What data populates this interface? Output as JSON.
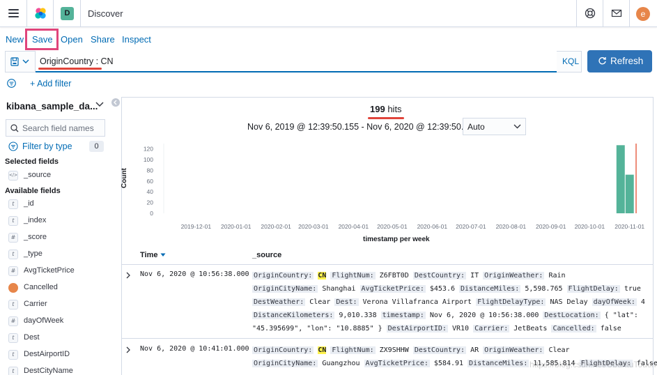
{
  "header": {
    "space_initial": "D",
    "app_title": "Discover",
    "user_initial": "e"
  },
  "nav": {
    "new": "New",
    "save": "Save",
    "open": "Open",
    "share": "Share",
    "inspect": "Inspect"
  },
  "query": {
    "value": "OriginCountry : CN",
    "language": "KQL",
    "refresh_label": "Refresh"
  },
  "filters": {
    "add_filter": "+ Add filter"
  },
  "sidebar": {
    "index_pattern": "kibana_sample_da...",
    "search_placeholder": "Search field names",
    "filter_by_type": "Filter by type",
    "filter_count": "0",
    "selected_title": "Selected fields",
    "selected_fields": [
      {
        "name": "_source",
        "type": "</>"
      }
    ],
    "available_title": "Available fields",
    "available_fields": [
      {
        "name": "_id",
        "type": "t"
      },
      {
        "name": "_index",
        "type": "t"
      },
      {
        "name": "_score",
        "type": "#"
      },
      {
        "name": "_type",
        "type": "t"
      },
      {
        "name": "AvgTicketPrice",
        "type": "#"
      },
      {
        "name": "Cancelled",
        "type": "bool"
      },
      {
        "name": "Carrier",
        "type": "t"
      },
      {
        "name": "dayOfWeek",
        "type": "#"
      },
      {
        "name": "Dest",
        "type": "t"
      },
      {
        "name": "DestAirportID",
        "type": "t"
      },
      {
        "name": "DestCityName",
        "type": "t"
      }
    ]
  },
  "results": {
    "hits_count": "199",
    "hits_label": "hits",
    "time_range": "Nov 6, 2019 @ 12:39:50.155 - Nov 6, 2020 @ 12:39:50.155",
    "interval": "Auto"
  },
  "chart_data": {
    "type": "bar",
    "ylabel": "Count",
    "xlabel": "timestamp per week",
    "ylim": [
      0,
      130
    ],
    "yticks": [
      "0",
      "20",
      "40",
      "60",
      "80",
      "100",
      "120"
    ],
    "xticks": [
      "2019-12-01",
      "2020-01-01",
      "2020-02-01",
      "2020-03-01",
      "2020-04-01",
      "2020-05-01",
      "2020-06-01",
      "2020-07-01",
      "2020-08-01",
      "2020-09-01",
      "2020-10-01",
      "2020-11-01"
    ],
    "bars": [
      {
        "x": "2020-10-25",
        "value": 127
      },
      {
        "x": "2020-11-01",
        "value": 72
      }
    ],
    "bar_color": "#54b399",
    "current_time_marker_color": "#e7664c"
  },
  "table": {
    "col_time": "Time",
    "col_source": "_source",
    "docs": [
      {
        "time": "Nov 6, 2020 @ 10:56:38.000",
        "lines": [
          [
            [
              "k",
              "OriginCountry:"
            ],
            [
              "s",
              " "
            ],
            [
              "hl",
              "CN"
            ],
            [
              "s",
              " "
            ],
            [
              "k",
              "FlightNum:"
            ],
            [
              "s",
              " Z6FBT0D "
            ],
            [
              "k",
              "DestCountry:"
            ],
            [
              "s",
              " IT "
            ],
            [
              "k",
              "OriginWeather:"
            ],
            [
              "s",
              " Rain"
            ]
          ],
          [
            [
              "k",
              "OriginCityName:"
            ],
            [
              "s",
              " Shanghai "
            ],
            [
              "k",
              "AvgTicketPrice:"
            ],
            [
              "s",
              " $453.6 "
            ],
            [
              "k",
              "DistanceMiles:"
            ],
            [
              "s",
              " 5,598.765 "
            ],
            [
              "k",
              "FlightDelay:"
            ],
            [
              "s",
              " true"
            ]
          ],
          [
            [
              "k",
              "DestWeather:"
            ],
            [
              "s",
              " Clear "
            ],
            [
              "k",
              "Dest:"
            ],
            [
              "s",
              " Verona Villafranca Airport "
            ],
            [
              "k",
              "FlightDelayType:"
            ],
            [
              "s",
              " NAS Delay "
            ],
            [
              "k",
              "dayOfWeek:"
            ],
            [
              "s",
              " 4"
            ]
          ],
          [
            [
              "k",
              "DistanceKilometers:"
            ],
            [
              "s",
              " 9,010.338 "
            ],
            [
              "k",
              "timestamp:"
            ],
            [
              "s",
              " Nov 6, 2020 @ 10:56:38.000 "
            ],
            [
              "k",
              "DestLocation:"
            ],
            [
              "s",
              " { \"lat\":"
            ]
          ],
          [
            [
              "s",
              "\"45.395699\", \"lon\": \"10.8885\" } "
            ],
            [
              "k",
              "DestAirportID:"
            ],
            [
              "s",
              " VR10 "
            ],
            [
              "k",
              "Carrier:"
            ],
            [
              "s",
              " JetBeats "
            ],
            [
              "k",
              "Cancelled:"
            ],
            [
              "s",
              " false"
            ]
          ]
        ]
      },
      {
        "time": "Nov 6, 2020 @ 10:41:01.000",
        "lines": [
          [
            [
              "k",
              "OriginCountry:"
            ],
            [
              "s",
              " "
            ],
            [
              "hl",
              "CN"
            ],
            [
              "s",
              " "
            ],
            [
              "k",
              "FlightNum:"
            ],
            [
              "s",
              " ZX9SHHW "
            ],
            [
              "k",
              "DestCountry:"
            ],
            [
              "s",
              " AR "
            ],
            [
              "k",
              "OriginWeather:"
            ],
            [
              "s",
              " Clear"
            ]
          ],
          [
            [
              "k",
              "OriginCityName:"
            ],
            [
              "s",
              " Guangzhou "
            ],
            [
              "k",
              "AvgTicketPrice:"
            ],
            [
              "s",
              " $584.91 "
            ],
            [
              "k",
              "DistanceMiles:"
            ],
            [
              "s",
              " 11,585.814 "
            ],
            [
              "k",
              "FlightDelay:"
            ],
            [
              "s",
              " false"
            ]
          ]
        ]
      }
    ]
  },
  "watermark": "https://blog.csdn.net/UbuntuTouch"
}
